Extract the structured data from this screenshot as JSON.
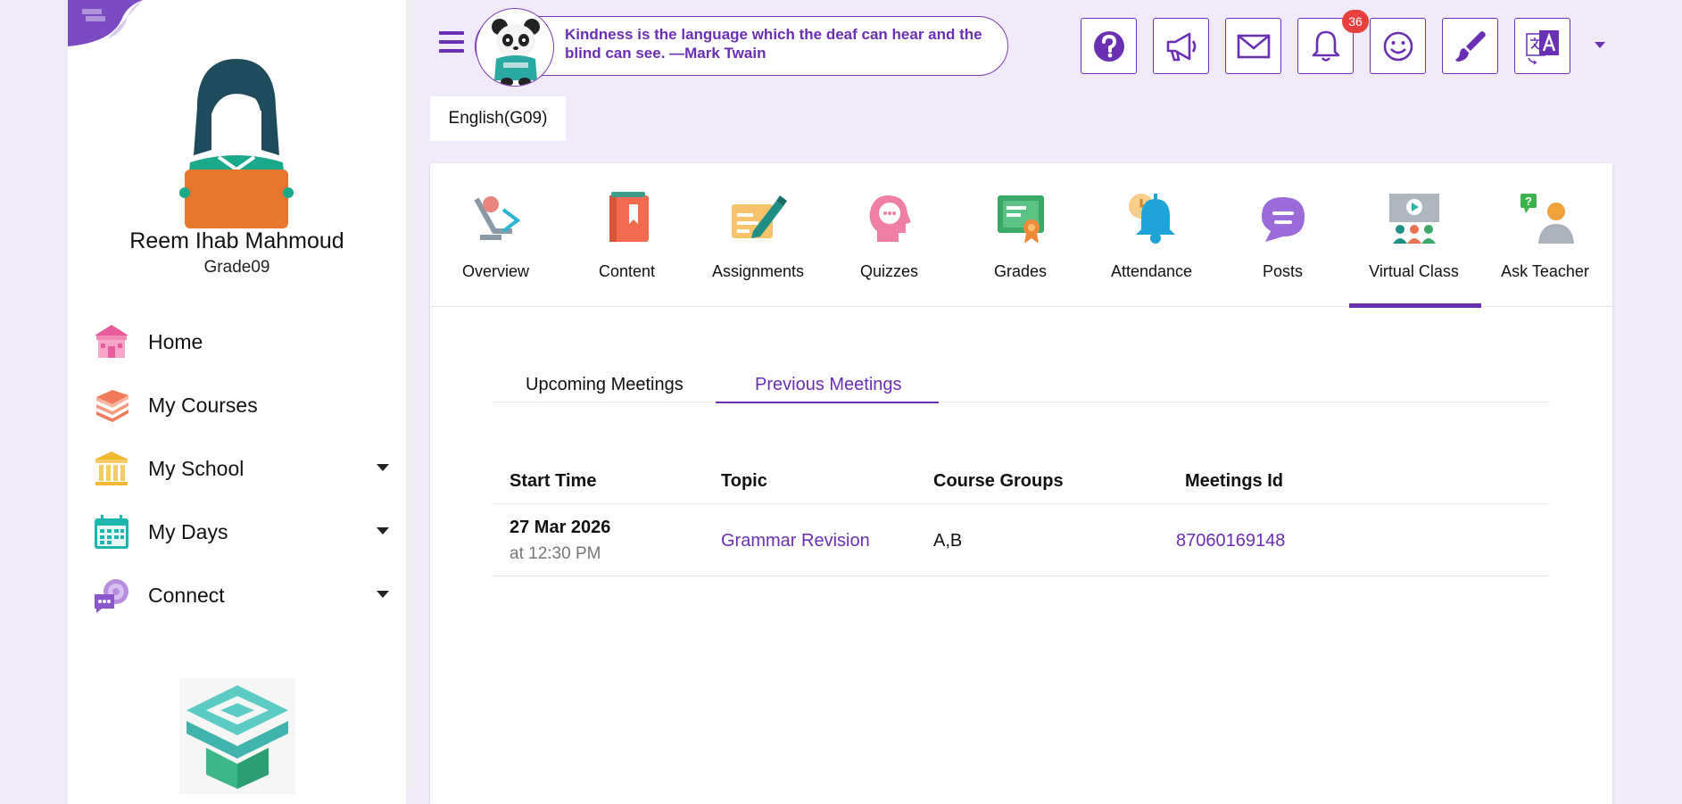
{
  "colors": {
    "accent": "#6b2fb3",
    "page_background": "#f0eafa",
    "badge": "#e8403f"
  },
  "user": {
    "name": "Reem Ihab Mahmoud",
    "grade": "Grade09"
  },
  "sidebar": {
    "items": [
      {
        "label": "Home",
        "icon": "home-icon"
      },
      {
        "label": "My Courses",
        "icon": "books-icon"
      },
      {
        "label": "My School",
        "icon": "school-icon"
      },
      {
        "label": "My Days",
        "icon": "calendar-icon"
      },
      {
        "label": "Connect",
        "icon": "chat-icon"
      }
    ]
  },
  "header": {
    "quote": "Kindness is the language which the deaf can hear and the blind can see. —Mark Twain",
    "notifications_count": "36",
    "buttons": [
      "help-icon",
      "megaphone-icon",
      "mail-icon",
      "bell-icon",
      "smiley-icon",
      "brush-icon",
      "translate-icon"
    ]
  },
  "course": {
    "name": "English(G09)"
  },
  "tabs": [
    {
      "label": "Overview"
    },
    {
      "label": "Content"
    },
    {
      "label": "Assignments"
    },
    {
      "label": "Quizzes"
    },
    {
      "label": "Grades"
    },
    {
      "label": "Attendance"
    },
    {
      "label": "Posts"
    },
    {
      "label": "Virtual Class"
    },
    {
      "label": "Ask Teacher"
    }
  ],
  "active_tab": "Virtual Class",
  "subtabs": {
    "upcoming": "Upcoming Meetings",
    "previous": "Previous Meetings",
    "active": "Previous Meetings"
  },
  "table": {
    "headers": {
      "start_time": "Start Time",
      "topic": "Topic",
      "course_groups": "Course Groups",
      "meetings_id": "Meetings Id"
    },
    "rows": [
      {
        "date": "27 Mar 2026",
        "time": "at 12:30 PM",
        "topic": "Grammar Revision",
        "course_groups": "A,B",
        "meetings_id": "87060169148"
      }
    ]
  }
}
